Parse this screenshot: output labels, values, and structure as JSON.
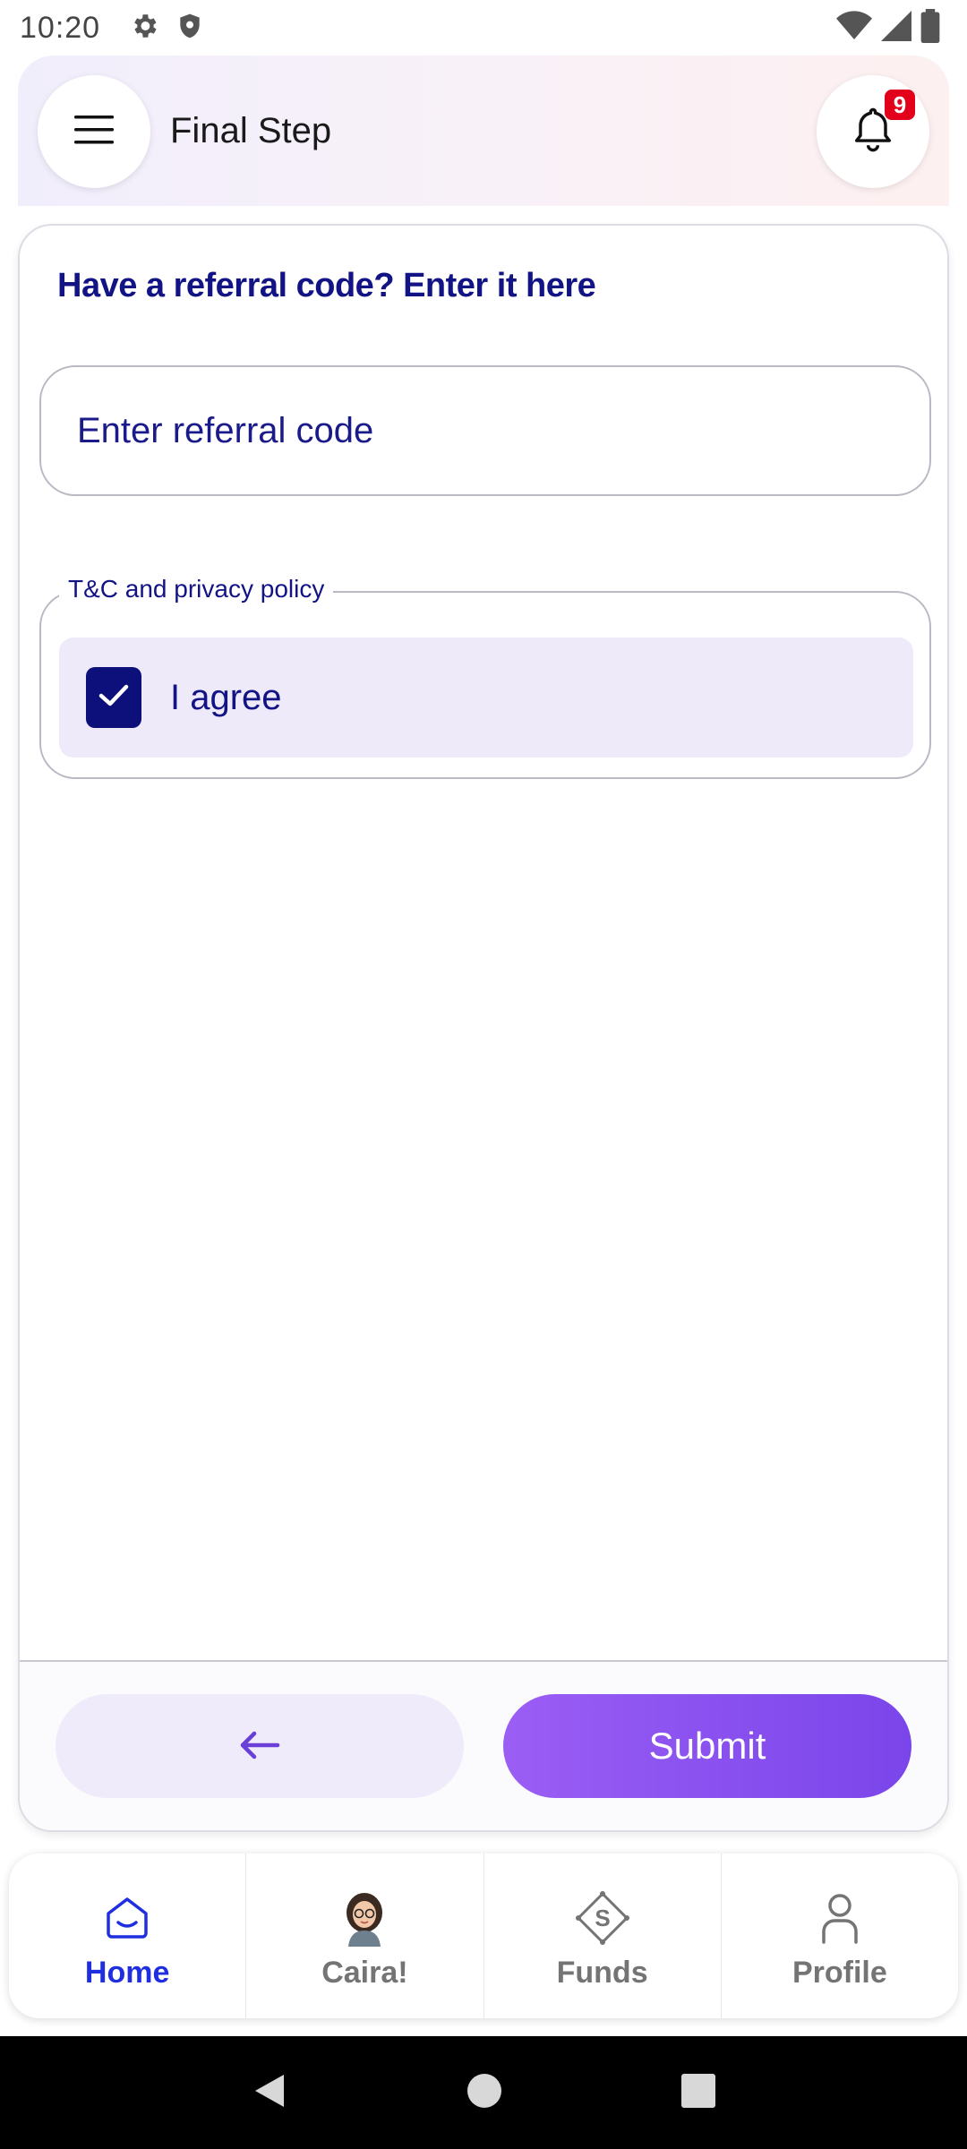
{
  "status_bar": {
    "time": "10:20"
  },
  "header": {
    "title": "Final Step",
    "notification_count": "9"
  },
  "referral": {
    "heading": "Have a referral code? Enter it here",
    "placeholder": "Enter referral code",
    "value": ""
  },
  "terms": {
    "legend": "T&C and privacy policy",
    "agree_label": "I agree",
    "checked": true
  },
  "actions": {
    "submit_label": "Submit"
  },
  "bottom_nav": {
    "items": [
      {
        "label": "Home",
        "icon": "home-icon",
        "active": true
      },
      {
        "label": "Caira!",
        "icon": "caira-avatar-icon",
        "active": false
      },
      {
        "label": "Funds",
        "icon": "funds-icon",
        "active": false
      },
      {
        "label": "Profile",
        "icon": "profile-icon",
        "active": false
      }
    ]
  },
  "colors": {
    "primary_text": "#121384",
    "accent_purple": "#7a45ea",
    "active_nav": "#1f2fe0",
    "badge_red": "#e3001b"
  }
}
